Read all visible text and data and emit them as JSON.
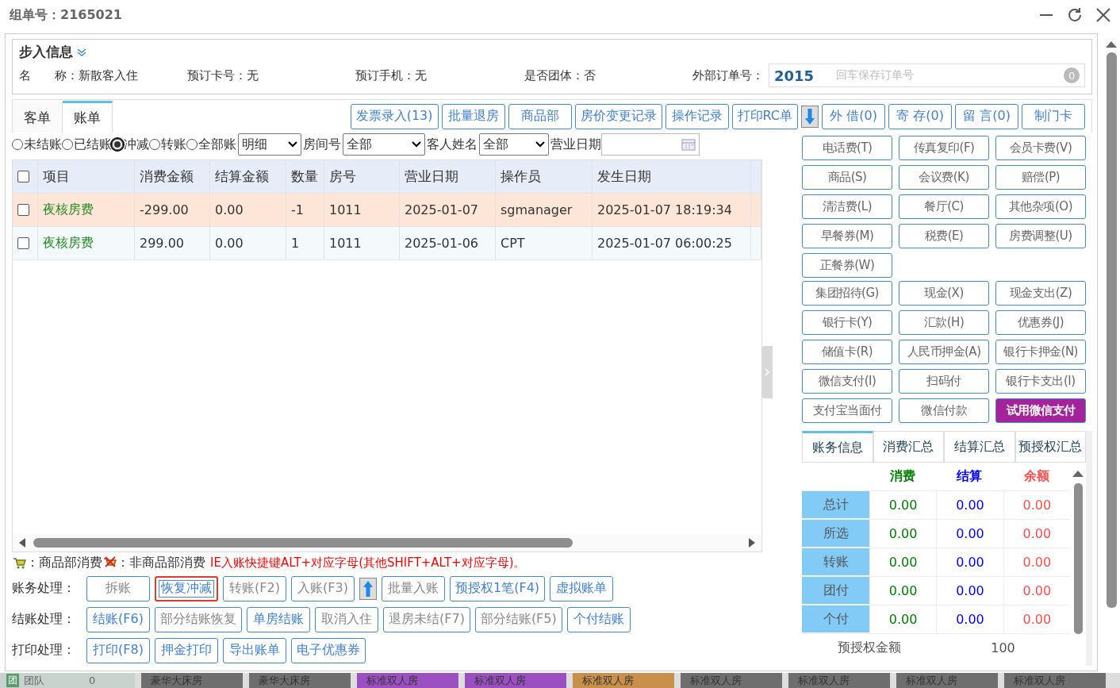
{
  "window": {
    "title": "组单号：2165021"
  },
  "checkin_info": {
    "legend": "步入信息",
    "fields": [
      {
        "label": "名　　称：",
        "value": "新散客入住"
      },
      {
        "label": "预订卡号：",
        "value": "无"
      },
      {
        "label": "预订手机：",
        "value": "无"
      },
      {
        "label": "是否团体：",
        "value": "否"
      }
    ],
    "external_order": {
      "label": "外部订单号：",
      "value": "2015",
      "hint": "回车保存订单号",
      "count": "0"
    }
  },
  "tabs": [
    {
      "label": "客单",
      "selected": false
    },
    {
      "label": "账单",
      "selected": true
    }
  ],
  "toolbar": [
    {
      "kind": "text",
      "label": "发票录入(13)"
    },
    {
      "kind": "text",
      "label": "批量退房"
    },
    {
      "kind": "text",
      "label": "商品部"
    },
    {
      "kind": "text",
      "label": "房价变更记录"
    },
    {
      "kind": "text",
      "label": "操作记录"
    },
    {
      "kind": "text",
      "label": "打印RC单"
    },
    {
      "kind": "down"
    },
    {
      "kind": "text",
      "label": "外 借(0)"
    },
    {
      "kind": "text",
      "label": "寄 存(0)"
    },
    {
      "kind": "text",
      "label": "留 言(0)"
    },
    {
      "kind": "text",
      "label": "制门卡"
    }
  ],
  "filters": {
    "radios": [
      {
        "label": "未结账",
        "selected": false
      },
      {
        "label": "已结账",
        "selected": false
      },
      {
        "label": "冲减",
        "selected": true
      },
      {
        "label": "转账",
        "selected": false
      },
      {
        "label": "全部账",
        "selected": false
      }
    ],
    "detail_select": "明细",
    "room_label": "房间号",
    "room_select": "全部",
    "guest_label": "客人姓名",
    "guest_select": "全部",
    "date_label": "营业日期"
  },
  "table": {
    "select_all": false,
    "columns": [
      "项目",
      "消费金额",
      "结算金额",
      "数量",
      "房号",
      "营业日期",
      "操作员",
      "发生日期"
    ],
    "rows": [
      {
        "selected": true,
        "checked": false,
        "cells": [
          "夜核房费",
          "-299.00",
          "0.00",
          "-1",
          "1011",
          "2025-01-07",
          "sgmanager",
          "2025-01-07 18:19:34"
        ]
      },
      {
        "selected": false,
        "checked": false,
        "cells": [
          "夜核房费",
          "299.00",
          "0.00",
          "1",
          "1011",
          "2025-01-06",
          "CPT",
          "2025-01-07 06:00:25"
        ]
      }
    ]
  },
  "legend": {
    "goods": "：商品部消费",
    "non_goods": "：非商品部消费",
    "hint": "IE入账快捷键ALT+对应字母(其他SHIFT+ALT+对应字母)。"
  },
  "action_rows": [
    {
      "label": "账务处理：",
      "buttons": [
        {
          "kind": "text",
          "label": "拆账",
          "disabled": true,
          "highlighted": false
        },
        {
          "kind": "text",
          "label": "恢复冲减",
          "disabled": false,
          "highlighted": true
        },
        {
          "kind": "text",
          "label": "转账(F2)",
          "disabled": true,
          "highlighted": false
        },
        {
          "kind": "text",
          "label": "入账(F3)",
          "disabled": true,
          "highlighted": false
        },
        {
          "kind": "up"
        },
        {
          "kind": "text",
          "label": "批量入账",
          "disabled": true,
          "highlighted": false
        },
        {
          "kind": "text",
          "label": "预授权1笔(F4)",
          "disabled": false,
          "highlighted": false
        },
        {
          "kind": "text",
          "label": "虚拟账单",
          "disabled": false,
          "highlighted": false
        }
      ]
    },
    {
      "label": "结账处理：",
      "buttons": [
        {
          "kind": "text",
          "label": "结账(F6)",
          "disabled": false,
          "highlighted": false
        },
        {
          "kind": "text",
          "label": "部分结账恢复",
          "disabled": true,
          "highlighted": false
        },
        {
          "kind": "text",
          "label": "单房结账",
          "disabled": false,
          "highlighted": false
        },
        {
          "kind": "text",
          "label": "取消入住",
          "disabled": true,
          "highlighted": false
        },
        {
          "kind": "text",
          "label": "退房未结(F7)",
          "disabled": true,
          "highlighted": false
        },
        {
          "kind": "text",
          "label": "部分结账(F5)",
          "disabled": true,
          "highlighted": false
        },
        {
          "kind": "text",
          "label": "个付结账",
          "disabled": false,
          "highlighted": false
        }
      ]
    },
    {
      "label": "打印处理：",
      "buttons": [
        {
          "kind": "text",
          "label": "打印(F8)",
          "disabled": false,
          "highlighted": false
        },
        {
          "kind": "text",
          "label": "押金打印",
          "disabled": false,
          "highlighted": false
        },
        {
          "kind": "text",
          "label": "导出账单",
          "disabled": false,
          "highlighted": false
        },
        {
          "kind": "text",
          "label": "电子优惠券",
          "disabled": false,
          "highlighted": false
        }
      ]
    }
  ],
  "charge_groups": [
    [
      {
        "kind": "normal",
        "label": "电话费(T)"
      },
      {
        "kind": "normal",
        "label": "传真复印(F)"
      },
      {
        "kind": "normal",
        "label": "会员卡费(V)"
      },
      {
        "kind": "normal",
        "label": "商品(S)"
      },
      {
        "kind": "normal",
        "label": "会议费(K)"
      },
      {
        "kind": "normal",
        "label": "赔偿(P)"
      },
      {
        "kind": "normal",
        "label": "清洁费(L)"
      },
      {
        "kind": "normal",
        "label": "餐厅(C)"
      },
      {
        "kind": "normal",
        "label": "其他杂项(O)"
      },
      {
        "kind": "normal",
        "label": "早餐券(M)"
      },
      {
        "kind": "normal",
        "label": "税费(E)"
      },
      {
        "kind": "normal",
        "label": "房费调整(U)"
      },
      {
        "kind": "normal",
        "label": "正餐券(W)"
      }
    ],
    [
      {
        "kind": "normal",
        "label": "集团招待(G)"
      },
      {
        "kind": "normal",
        "label": "现金(X)"
      },
      {
        "kind": "normal",
        "label": "现金支出(Z)"
      },
      {
        "kind": "normal",
        "label": "银行卡(Y)"
      },
      {
        "kind": "normal",
        "label": "汇款(H)"
      },
      {
        "kind": "normal",
        "label": "优惠券(J)"
      },
      {
        "kind": "normal",
        "label": "储值卡(R)"
      },
      {
        "kind": "normal",
        "label": "人民币押金(A)"
      },
      {
        "kind": "normal",
        "label": "银行卡押金(N)"
      },
      {
        "kind": "normal",
        "label": "微信支付(I)"
      },
      {
        "kind": "normal",
        "label": "扫码付"
      },
      {
        "kind": "normal",
        "label": "银行卡支出(I)"
      },
      {
        "kind": "normal",
        "label": "支付宝当面付"
      },
      {
        "kind": "normal",
        "label": "微信付款"
      },
      {
        "kind": "promo",
        "label": "试用微信支付"
      }
    ]
  ],
  "summary": {
    "tabs": [
      {
        "label": "账务信息",
        "selected": true
      },
      {
        "label": "消费汇总",
        "selected": false
      },
      {
        "label": "结算汇总",
        "selected": false
      },
      {
        "label": "预授权汇总",
        "selected": false
      }
    ],
    "columns": [
      {
        "label": "消费",
        "color": "#008000"
      },
      {
        "label": "结算",
        "color": "#0000ff"
      },
      {
        "label": "余额",
        "color": "#ff4d4d"
      }
    ],
    "rows": [
      {
        "label": "总计",
        "values": [
          "0.00",
          "0.00",
          "0.00"
        ]
      },
      {
        "label": "所选",
        "values": [
          "0.00",
          "0.00",
          "0.00"
        ]
      },
      {
        "label": "转账",
        "values": [
          "0.00",
          "0.00",
          "0.00"
        ]
      },
      {
        "label": "团付",
        "values": [
          "0.00",
          "0.00",
          "0.00"
        ]
      },
      {
        "label": "个付",
        "values": [
          "0.00",
          "0.00",
          "0.00"
        ]
      }
    ],
    "footer": {
      "label": "预授权金额",
      "value": "100"
    }
  },
  "background_rooms": {
    "group": {
      "badge": "团",
      "label": "团队",
      "count": "0"
    },
    "tiles": [
      {
        "label": "豪华大床房",
        "color": "#6e6e6e"
      },
      {
        "label": "豪华大床房",
        "color": "#6e6e6e"
      },
      {
        "label": "标准双人房",
        "color": "#9b4fc0"
      },
      {
        "label": "标准双人房",
        "color": "#9b4fc0"
      },
      {
        "label": "标准双人房",
        "color": "#c8904a"
      },
      {
        "label": "标准双人房",
        "color": "#6e6e6e"
      },
      {
        "label": "标准双人房",
        "color": "#6e6e6e"
      },
      {
        "label": "标准双人房",
        "color": "#6e6e6e"
      },
      {
        "label": "标准双人房",
        "color": "#6e6e6e"
      }
    ]
  }
}
